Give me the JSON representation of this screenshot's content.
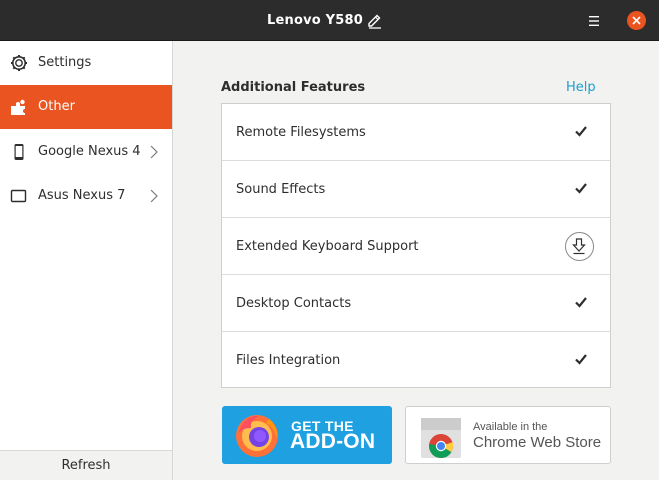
{
  "window": {
    "title": "Lenovo Y580",
    "rename_icon": "pencil-icon",
    "menu_icon": "hamburger-menu-icon",
    "close_icon": "close-icon"
  },
  "sidebar": {
    "items": [
      {
        "label": "Settings",
        "icon": "gear-icon",
        "active": false
      },
      {
        "label": "Other",
        "icon": "puzzle-icon",
        "active": true
      },
      {
        "label": "Google Nexus 4",
        "icon": "phone-icon",
        "active": false,
        "chevron": true
      },
      {
        "label": "Asus Nexus 7",
        "icon": "tablet-icon",
        "active": false,
        "chevron": true
      }
    ],
    "refresh_label": "Refresh"
  },
  "main": {
    "section_title": "Additional Features",
    "help_label": "Help",
    "features": [
      {
        "name": "Remote Filesystems",
        "status": "installed"
      },
      {
        "name": "Sound Effects",
        "status": "installed"
      },
      {
        "name": "Extended Keyboard Support",
        "status": "install"
      },
      {
        "name": "Desktop Contacts",
        "status": "installed"
      },
      {
        "name": "Files Integration",
        "status": "installed"
      }
    ]
  },
  "badges": {
    "firefox": {
      "line1": "GET THE",
      "line2": "ADD-ON"
    },
    "chrome": {
      "line1": "Available in the",
      "line2": "Chrome Web Store"
    }
  },
  "colors": {
    "accent": "#e95420",
    "link": "#19a0cf",
    "header": "#2c2c2c",
    "firefox_badge": "#1ea0e1"
  }
}
